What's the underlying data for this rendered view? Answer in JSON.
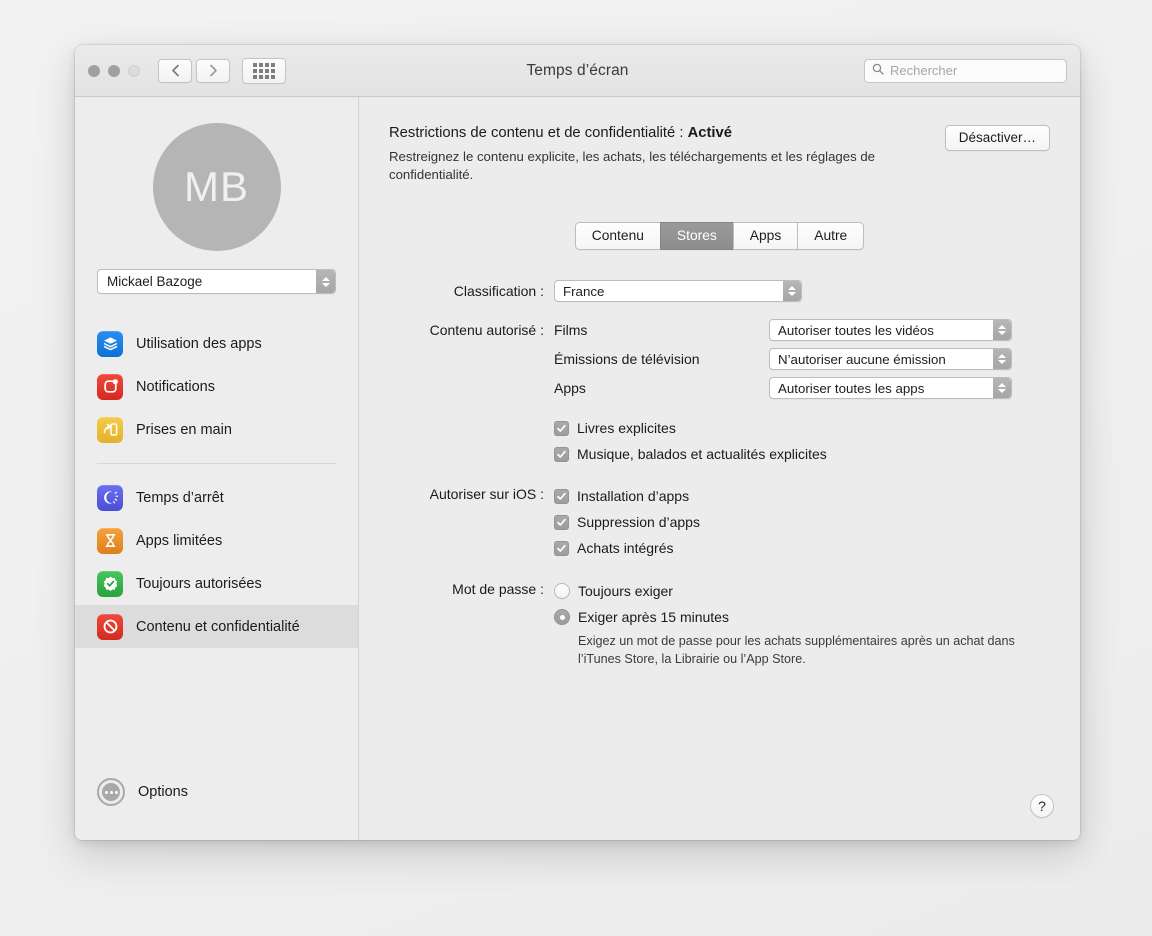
{
  "window": {
    "title": "Temps d’écran",
    "traffic_lights": [
      "close",
      "minimize",
      "zoom"
    ],
    "nav_back": "back-icon",
    "nav_forward": "forward-icon",
    "grid_button": "all-preferences-grid-icon"
  },
  "search": {
    "placeholder": "Rechercher",
    "value": "",
    "icon": "search-icon"
  },
  "sidebar": {
    "avatar_initials": "MB",
    "user_popup_value": "Mickael Bazoge",
    "items": [
      {
        "label": "Utilisation des apps",
        "icon": "layers-icon",
        "color": "#1a7fe8",
        "selected": false
      },
      {
        "label": "Notifications",
        "icon": "notification-badge-icon",
        "color": "#e03b30",
        "selected": false
      },
      {
        "label": "Prises en main",
        "icon": "pickup-arrow-icon",
        "color": "#f0c038",
        "selected": false
      }
    ],
    "items2": [
      {
        "label": "Temps d’arrêt",
        "icon": "downtime-moon-icon",
        "color": "#5a5fe0",
        "selected": false
      },
      {
        "label": "Apps limitées",
        "icon": "hourglass-icon",
        "color": "#e8932a",
        "selected": false
      },
      {
        "label": "Toujours autorisées",
        "icon": "check-badge-icon",
        "color": "#39b54a",
        "selected": false
      },
      {
        "label": "Contenu et confidentialité",
        "icon": "prohibition-icon",
        "color": "#e03b30",
        "selected": true
      }
    ],
    "options_label": "Options",
    "options_icon": "ellipsis-circle-icon"
  },
  "main": {
    "header_prefix": "Restrictions de contenu et de confidentialité : ",
    "header_status": "Activé",
    "header_description": "Restreignez le contenu explicite, les achats, les téléchargements et les réglages de confidentialité.",
    "disable_button": "Désactiver…",
    "tabs": [
      {
        "label": "Contenu",
        "active": false
      },
      {
        "label": "Stores",
        "active": true
      },
      {
        "label": "Apps",
        "active": false
      },
      {
        "label": "Autre",
        "active": false
      }
    ],
    "classification": {
      "label": "Classification :",
      "value": "France"
    },
    "allowed_content": {
      "label": "Contenu autorisé :",
      "rows": [
        {
          "name": "Films",
          "value": "Autoriser toutes les vidéos"
        },
        {
          "name": "Émissions de télévision",
          "value": "N’autoriser aucune émission"
        },
        {
          "name": "Apps",
          "value": "Autoriser toutes les apps"
        }
      ],
      "checkboxes": [
        {
          "label": "Livres explicites",
          "checked": true
        },
        {
          "label": "Musique, balados et actualités explicites",
          "checked": true
        }
      ]
    },
    "allow_on_ios": {
      "label": "Autoriser sur iOS :",
      "checkboxes": [
        {
          "label": "Installation d’apps",
          "checked": true
        },
        {
          "label": "Suppression d’apps",
          "checked": true
        },
        {
          "label": "Achats intégrés",
          "checked": true
        }
      ]
    },
    "password": {
      "label": "Mot de passe :",
      "options": [
        {
          "label": "Toujours exiger",
          "selected": false
        },
        {
          "label": "Exiger après 15 minutes",
          "selected": true
        }
      ],
      "help": "Exigez un mot de passe pour les achats supplémentaires après un achat dans l’iTunes Store, la Librairie ou l’App Store."
    },
    "help_button": "?"
  }
}
